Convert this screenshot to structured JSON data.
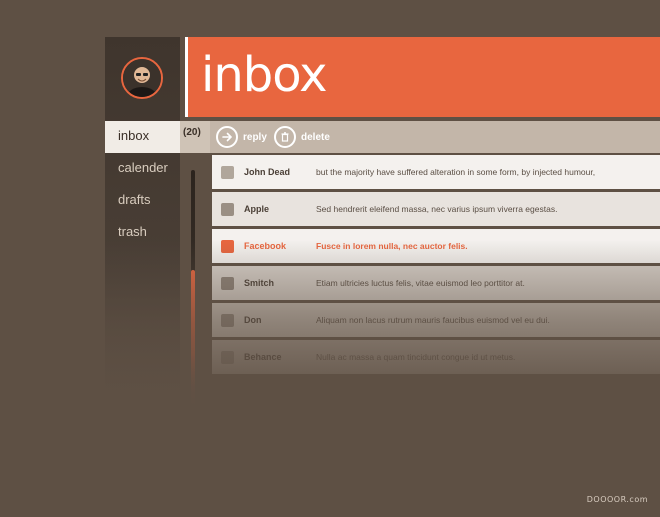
{
  "header": {
    "title": "inbox"
  },
  "sidebar": {
    "items": [
      {
        "label": "inbox",
        "count": "(20)"
      },
      {
        "label": "calender"
      },
      {
        "label": "drafts"
      },
      {
        "label": "trash"
      }
    ]
  },
  "toolbar": {
    "reply_label": "reply",
    "delete_label": "delete"
  },
  "messages": [
    {
      "sender": "John Dead",
      "subject": "but the majority have suffered alteration in some form, by injected humour,"
    },
    {
      "sender": "Apple",
      "subject": "Sed hendrerit eleifend massa, nec varius ipsum viverra egestas."
    },
    {
      "sender": "Facebook",
      "subject": "Fusce in lorem nulla, nec auctor felis."
    },
    {
      "sender": "Smitch",
      "subject": "Etiam ultricies luctus felis, vitae euismod leo porttitor at."
    },
    {
      "sender": "Don",
      "subject": "Aliquam non lacus rutrum mauris faucibus euismod vel eu dui."
    },
    {
      "sender": "Behance",
      "subject": "Nulla ac massa a quam tincidunt congue id ut metus."
    }
  ],
  "colors": {
    "accent": "#e8663f",
    "background": "#5e5044",
    "toolbar": "#c3b6a9"
  },
  "watermark": "DOOOOR.com"
}
